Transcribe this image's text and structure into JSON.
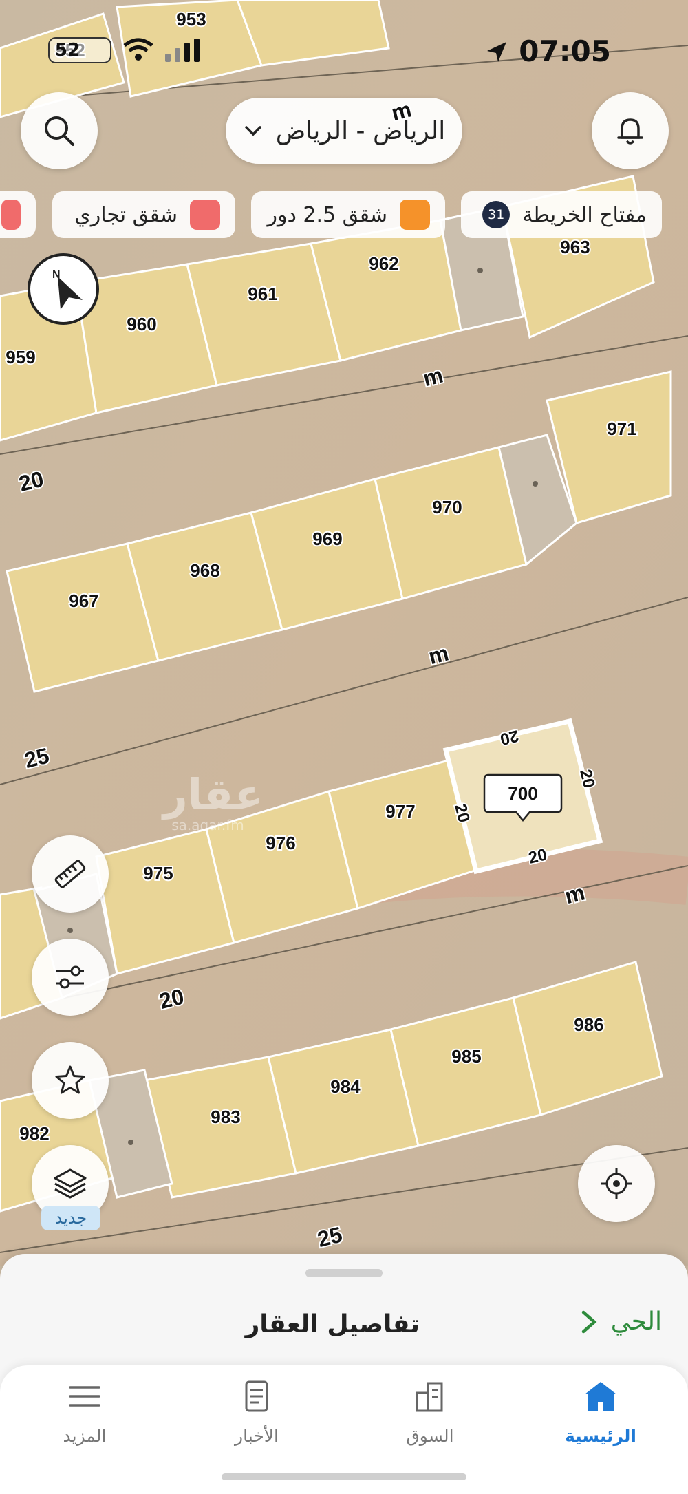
{
  "status_bar": {
    "time": "07:05",
    "battery": "52"
  },
  "header": {
    "city": "الرياض - الرياض"
  },
  "legend": {
    "map_key_label": "مفتاح الخريطة",
    "map_key_count": "31",
    "chips": [
      {
        "label": "شقق 2.5 دور",
        "color": "#f5922a"
      },
      {
        "label": "شقق تجاري",
        "color": "#f06b6b"
      }
    ]
  },
  "map": {
    "watermark": {
      "name": "عقار",
      "domain": "sa.aqar.fm"
    },
    "plot_numbers": [
      "952",
      "953",
      "959",
      "960",
      "961",
      "962",
      "963",
      "967",
      "968",
      "969",
      "970",
      "971",
      "975",
      "976",
      "977",
      "982",
      "983",
      "984",
      "985",
      "986"
    ],
    "street_widths": [
      "20",
      "20",
      "25",
      "25"
    ],
    "street_marks": [
      "m",
      "m",
      "m",
      "m"
    ],
    "selected_parcel": {
      "label": "700",
      "side_lengths": [
        "20",
        "20",
        "20",
        "20"
      ]
    }
  },
  "tools": {
    "new_badge": "جديد"
  },
  "bottom_sheet": {
    "title": "تفاصيل العقار",
    "district": "الحي"
  },
  "nav": {
    "items": [
      "الرئيسية",
      "السوق",
      "الأخبار",
      "المزيد"
    ]
  },
  "colors": {
    "plot_fill": "#e9d597",
    "accent": "#1f7ad6",
    "district_green": "#2e8b3c"
  }
}
